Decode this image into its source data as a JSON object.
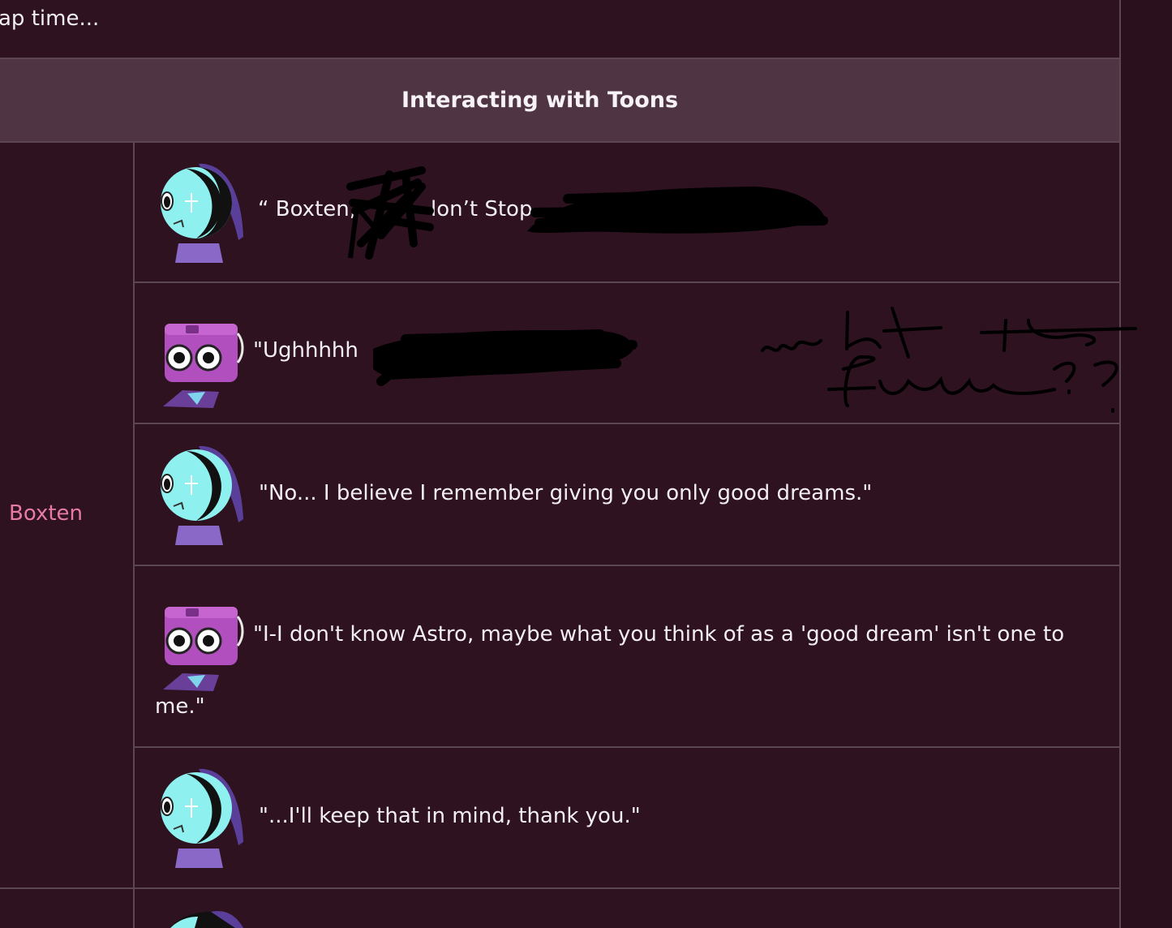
{
  "top_text": "ap time...",
  "section_header": "Interacting with Toons",
  "row_label": "Boxten",
  "dialogue": [
    {
      "speaker_icon": "astro-avatar-icon",
      "text": "“ Boxten,",
      "text_b": "lon’t Stop"
    },
    {
      "speaker_icon": "boxten-avatar-icon",
      "text": "\"Ughhhhh"
    },
    {
      "speaker_icon": "astro-avatar-icon",
      "text": "\"No... I believe I remember giving you only good dreams.\""
    },
    {
      "speaker_icon": "boxten-avatar-icon",
      "text": "\"I-I don't know Astro, maybe what you think of as a 'good dream' isn't one to",
      "text_cont": "me.\""
    },
    {
      "speaker_icon": "astro-avatar-icon",
      "text": "\"...I'll keep that in mind, thank you.\""
    }
  ],
  "colors": {
    "background": "#2e1220",
    "header_band": "#4f3544",
    "grid_line": "#5c4654",
    "name_accent": "#e77ba7",
    "redaction": "#000000"
  }
}
